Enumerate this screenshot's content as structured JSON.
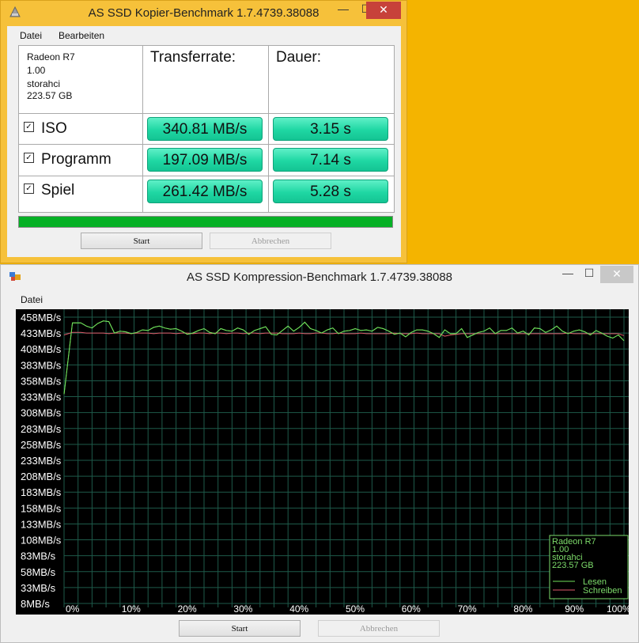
{
  "copy_window": {
    "title": "AS SSD Kopier-Benchmark 1.7.4739.38088",
    "controls": {
      "minimize": "—",
      "maximize": "☐",
      "close": "✕"
    },
    "menu": [
      "Datei",
      "Bearbeiten"
    ],
    "device": {
      "name": "Radeon R7",
      "version": "1.00",
      "driver": "storahci",
      "size": "223.57 GB"
    },
    "headers": {
      "transfer": "Transferrate:",
      "duration": "Dauer:"
    },
    "rows": [
      {
        "label": "ISO",
        "checked": true,
        "rate": "340.81 MB/s",
        "time": "3.15 s"
      },
      {
        "label": "Programm",
        "checked": true,
        "rate": "197.09 MB/s",
        "time": "7.14 s"
      },
      {
        "label": "Spiel",
        "checked": true,
        "rate": "261.42 MB/s",
        "time": "5.28 s"
      }
    ],
    "progress": 1.0,
    "buttons": {
      "start": "Start",
      "cancel": "Abbrechen"
    },
    "accent_color": "#1fd7a3",
    "progress_color": "#06b025"
  },
  "compression_window": {
    "title": "AS SSD Kompression-Benchmark 1.7.4739.38088",
    "controls": {
      "minimize": "—",
      "maximize": "☐",
      "close": "✕"
    },
    "menu": [
      "Datei"
    ],
    "legend": {
      "device": "Radeon R7",
      "version": "1.00",
      "driver": "storahci",
      "size": "223.57 GB"
    },
    "buttons": {
      "start": "Start",
      "cancel": "Abbrechen"
    }
  },
  "chart_data": {
    "type": "line",
    "background": "#000000",
    "grid_color": "#1e5a4a",
    "text_color": "#ffffff",
    "legend_position": "bottom-right",
    "xlabel": "",
    "ylabel": "",
    "ylim": [
      8,
      458
    ],
    "yticks": [
      "458MB/s",
      "433MB/s",
      "408MB/s",
      "383MB/s",
      "358MB/s",
      "333MB/s",
      "308MB/s",
      "283MB/s",
      "258MB/s",
      "233MB/s",
      "208MB/s",
      "183MB/s",
      "158MB/s",
      "133MB/s",
      "108MB/s",
      "83MB/s",
      "58MB/s",
      "33MB/s",
      "8MB/s"
    ],
    "xticks": [
      "0%",
      "10%",
      "20%",
      "30%",
      "40%",
      "50%",
      "60%",
      "70%",
      "80%",
      "90%",
      "100%"
    ],
    "x": [
      0,
      1.5,
      3,
      4,
      5,
      6,
      7,
      8,
      9,
      10,
      11,
      12,
      13,
      14,
      15,
      16,
      17,
      18,
      19,
      20,
      21,
      22,
      23,
      24,
      25,
      26,
      27,
      28,
      29,
      30,
      31,
      32,
      33,
      34,
      35,
      36,
      37,
      38,
      39,
      40,
      41,
      42,
      43,
      44,
      45,
      46,
      47,
      48,
      49,
      50,
      51,
      52,
      53,
      54,
      55,
      56,
      57,
      58,
      59,
      60,
      61,
      62,
      63,
      64,
      65,
      66,
      67,
      68,
      69,
      70,
      71,
      72,
      73,
      74,
      75,
      76,
      77,
      78,
      79,
      80,
      81,
      82,
      83,
      84,
      85,
      86,
      87,
      88,
      89,
      90,
      91,
      92,
      93,
      94,
      95,
      96,
      97,
      98,
      99,
      100
    ],
    "series": [
      {
        "name": "Lesen",
        "color": "#6fe05a",
        "values": [
          337,
          449,
          449,
          444,
          441,
          448,
          452,
          451,
          433,
          436,
          435,
          432,
          434,
          438,
          437,
          442,
          444,
          441,
          439,
          440,
          436,
          431,
          433,
          437,
          440,
          434,
          432,
          440,
          437,
          436,
          441,
          438,
          431,
          437,
          440,
          443,
          431,
          430,
          437,
          444,
          436,
          442,
          450,
          440,
          437,
          433,
          438,
          441,
          432,
          436,
          437,
          440,
          437,
          438,
          436,
          442,
          440,
          436,
          431,
          433,
          427,
          434,
          438,
          438,
          436,
          432,
          426,
          438,
          432,
          432,
          440,
          426,
          430,
          434,
          436,
          441,
          432,
          437,
          437,
          441,
          433,
          436,
          430,
          441,
          440,
          434,
          438,
          444,
          436,
          432,
          436,
          438,
          435,
          430,
          437,
          433,
          428,
          425,
          430,
          421
        ]
      },
      {
        "name": "Schreiben",
        "color": "#e05a6a",
        "values": [
          430,
          434,
          434,
          433,
          433,
          433,
          433,
          432,
          433,
          433,
          433,
          432,
          433,
          433,
          433,
          432,
          433,
          433,
          433,
          432,
          433,
          433,
          432,
          433,
          433,
          432,
          433,
          433,
          432,
          433,
          433,
          432,
          433,
          433,
          432,
          433,
          433,
          433,
          432,
          432,
          432,
          433,
          432,
          432,
          433,
          433,
          432,
          432,
          433,
          432,
          432,
          432,
          433,
          432,
          432,
          432,
          432,
          432,
          433,
          432,
          432,
          432,
          433,
          432,
          432,
          432,
          432,
          428,
          430,
          431,
          432,
          432,
          432,
          432,
          432,
          432,
          432,
          432,
          432,
          432,
          432,
          432,
          432,
          432,
          432,
          432,
          432,
          432,
          432,
          433,
          432,
          432,
          432,
          432,
          432,
          432,
          432,
          432,
          432,
          429
        ]
      }
    ]
  }
}
